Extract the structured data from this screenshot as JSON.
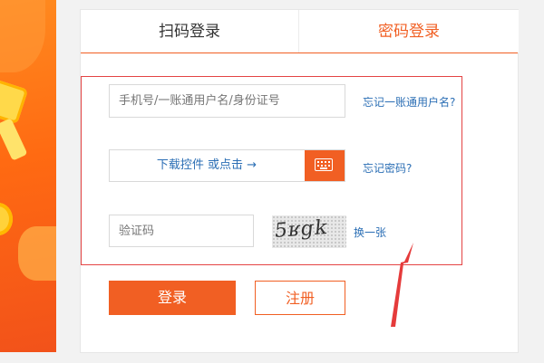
{
  "tabs": {
    "qr_login": "扫码登录",
    "password_login": "密码登录"
  },
  "form": {
    "account_placeholder": "手机号/一账通用户名/身份证号",
    "password_download_link": "下载控件 或点击 →",
    "captcha_placeholder": "验证码",
    "captcha_code": "5ʁgk"
  },
  "links": {
    "forgot_account": "忘记一账通用户名?",
    "forgot_password": "忘记密码?",
    "refresh_captcha": "换一张"
  },
  "buttons": {
    "login": "登录",
    "register": "注册"
  },
  "icons": {
    "keyboard": "keyboard-icon",
    "annotation_arrow": "red-arrow"
  },
  "colors": {
    "accent": "#f15f23",
    "link": "#2c6fb5",
    "highlight": "#e44444"
  }
}
